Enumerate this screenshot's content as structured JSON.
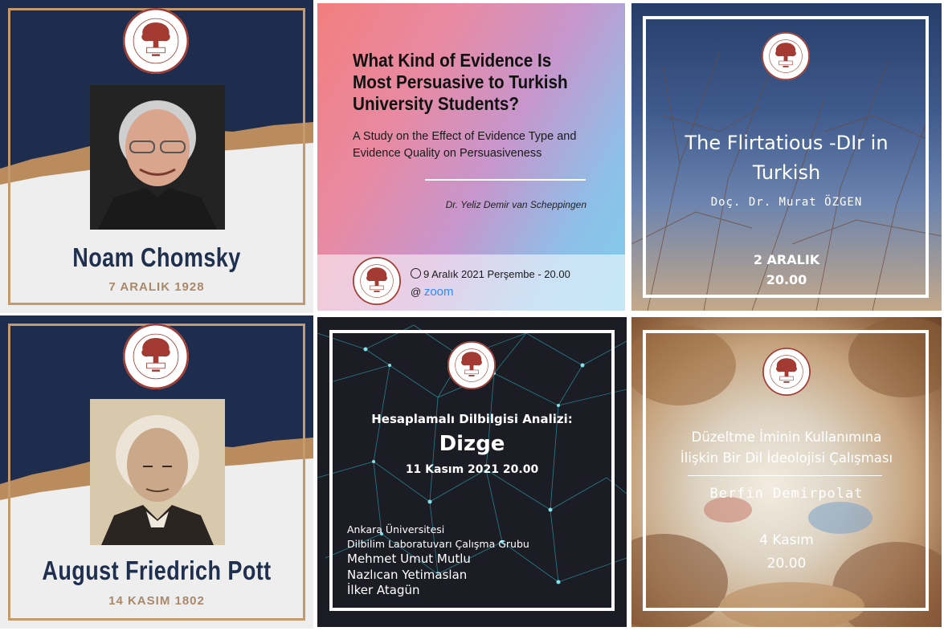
{
  "logo": {
    "arc_top": "HACETTEPE ÜNİVERSİTESİ",
    "arc_bottom": "DİLBİLİM TOPLULUĞU",
    "wordmark": "[dilbilim]",
    "year": "2009"
  },
  "tiles": {
    "chomsky": {
      "name": "Noam Chomsky",
      "date": "7 ARALIK 1928"
    },
    "evidence": {
      "title": "What Kind of Evidence Is Most Persuasive to Turkish University Students?",
      "subtitle": "A Study on the Effect of Evidence Type and Evidence Quality on Persuasiveness",
      "author": "Dr. Yeliz Demir van Scheppingen",
      "when": "9 Aralık 2021 Perşembe - 20.00",
      "at": "@",
      "platform": "zoom"
    },
    "flirtatious": {
      "title_line1": "The Flirtatious -DIr in",
      "title_line2": "Turkish",
      "speaker": "Doç. Dr. Murat ÖZGEN",
      "date": "2 ARALIK",
      "time": "20.00"
    },
    "pott": {
      "name": "August Friedrich Pott",
      "date": "14 KASIM 1802"
    },
    "dizge": {
      "heading": "Hesaplamalı Dilbilgisi Analizi:",
      "title": "Dizge",
      "date": "11 Kasım 2021 20.00",
      "org1": "Ankara Üniversitesi",
      "org2": "Dilbilim Laboratuvarı Çalışma Grubu",
      "people": [
        "Mehmet Umut Mutlu",
        "Nazlıcan Yetimaslan",
        "İlker Atagün"
      ]
    },
    "duzeltme": {
      "title_line1": "Düzeltme İminin Kullanımına",
      "title_line2": "İlişkin Bir Dil İdeolojisi Çalışması",
      "speaker": "Berfin Demirpolat",
      "date": "4 Kasım",
      "time": "20.00"
    }
  },
  "colors": {
    "navy": "#1e2d4d",
    "gold": "#c49a6c",
    "logo_red": "#a33b32",
    "zoom_blue": "#2d8cff"
  },
  "icons": [
    "university-logo",
    "clock-icon",
    "zoom-logo"
  ]
}
